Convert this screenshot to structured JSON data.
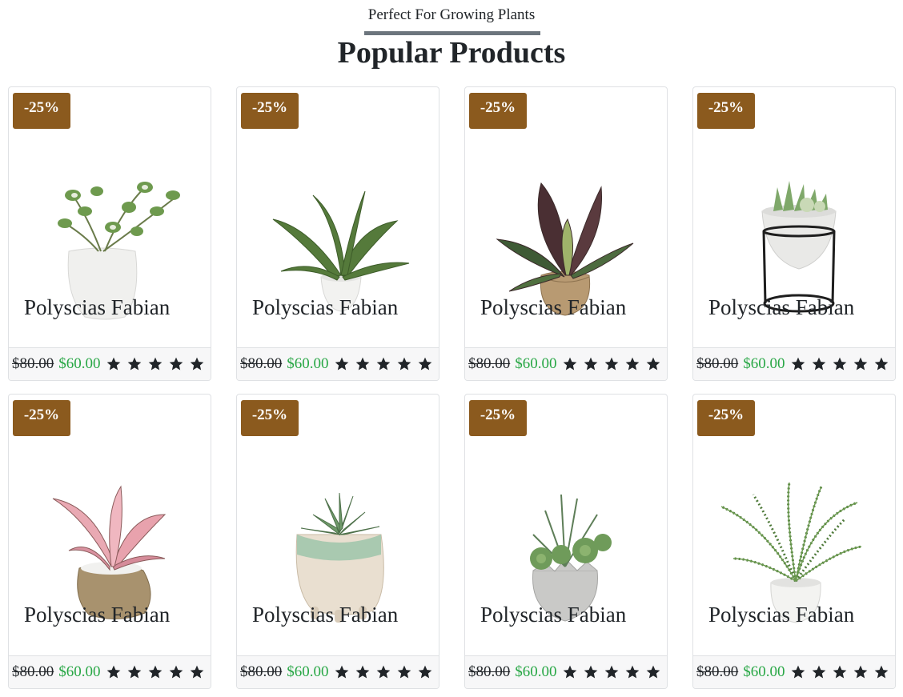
{
  "header": {
    "subtitle": "Perfect For Growing Plants",
    "title": "Popular Products"
  },
  "colors": {
    "badge": "#8b5a1e",
    "new_price": "#28a745",
    "star": "#212529",
    "subtitle_bar": "#6c757d"
  },
  "products": [
    {
      "badge": "-25%",
      "name": "Polyscias Fabian",
      "old_price": "$80.00",
      "new_price": "$60.00",
      "rating": 5,
      "image": "variegated-ivy-white-pot"
    },
    {
      "badge": "-25%",
      "name": "Polyscias Fabian",
      "old_price": "$80.00",
      "new_price": "$60.00",
      "rating": 5,
      "image": "birds-nest-fern-white-pot"
    },
    {
      "badge": "-25%",
      "name": "Polyscias Fabian",
      "old_price": "$80.00",
      "new_price": "$60.00",
      "rating": 5,
      "image": "calathea-burlap-pot"
    },
    {
      "badge": "-25%",
      "name": "Polyscias Fabian",
      "old_price": "$80.00",
      "new_price": "$60.00",
      "rating": 5,
      "image": "succulent-bowl-on-stand"
    },
    {
      "badge": "-25%",
      "name": "Polyscias Fabian",
      "old_price": "$80.00",
      "new_price": "$60.00",
      "rating": 5,
      "image": "pink-aglaonema-burlap-pot"
    },
    {
      "badge": "-25%",
      "name": "Polyscias Fabian",
      "old_price": "$80.00",
      "new_price": "$60.00",
      "rating": 5,
      "image": "echeveria-ceramic-pot"
    },
    {
      "badge": "-25%",
      "name": "Polyscias Fabian",
      "old_price": "$80.00",
      "new_price": "$60.00",
      "rating": 5,
      "image": "succulents-concrete-pot"
    },
    {
      "badge": "-25%",
      "name": "Polyscias Fabian",
      "old_price": "$80.00",
      "new_price": "$60.00",
      "rating": 5,
      "image": "boston-fern-white-pot"
    }
  ]
}
